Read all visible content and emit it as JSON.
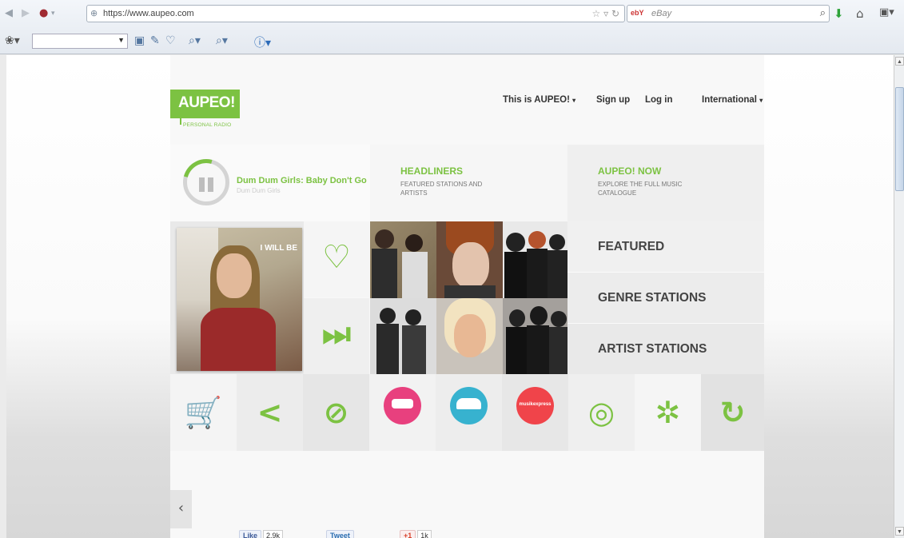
{
  "browser": {
    "url": "https://www.aupeo.com",
    "search_placeholder": "eBay",
    "search_engine": "ebY"
  },
  "site": {
    "logo": "AUPEO!",
    "tagline": "PERSONAL RADIO",
    "brand_color": "#7cc242",
    "nav": [
      {
        "label": "This is AUPEO!",
        "has_dropdown": true
      },
      {
        "label": "Sign up"
      },
      {
        "label": "Log in"
      },
      {
        "label": "International",
        "has_dropdown": true
      }
    ]
  },
  "player": {
    "track_title": "Dum Dum Girls: Baby Don't Go",
    "artist": "Dum Dum Girls",
    "album_art_text": "I WILL BE"
  },
  "tiles": [
    {
      "title": "HEADLINERS",
      "desc": "FEATURED STATIONS AND ARTISTS"
    },
    {
      "title": "AUPEO! NOW",
      "desc": "EXPLORE THE FULL MUSIC CATALOGUE"
    }
  ],
  "menu": [
    "FEATURED",
    "GENRE STATIONS",
    "ARTIST STATIONS"
  ],
  "actions": [
    {
      "icon": "heart-icon",
      "glyph": "♡"
    },
    {
      "icon": "skip-icon",
      "glyph": "⏭"
    }
  ],
  "bottom_icons": [
    {
      "icon": "cart-icon",
      "glyph": "🛒"
    },
    {
      "icon": "share-icon",
      "glyph": "<"
    },
    {
      "icon": "ban-icon",
      "glyph": "⊘"
    },
    {
      "icon": "badge-pink",
      "color": "#e8407e",
      "label": ""
    },
    {
      "icon": "badge-blue",
      "color": "#37b2cf",
      "label": ""
    },
    {
      "icon": "badge-red",
      "color": "#f0444a",
      "label": "musikexpress"
    },
    {
      "icon": "target-icon",
      "glyph": "◎"
    },
    {
      "icon": "virus-icon",
      "glyph": "✲"
    },
    {
      "icon": "refresh-icon",
      "glyph": "↻"
    }
  ],
  "social": {
    "like_label": "Like",
    "like_count": "2.9k",
    "tweet_label": "Tweet",
    "plus_label": "+1",
    "plus_count": "1k"
  },
  "prev_label": "‹"
}
